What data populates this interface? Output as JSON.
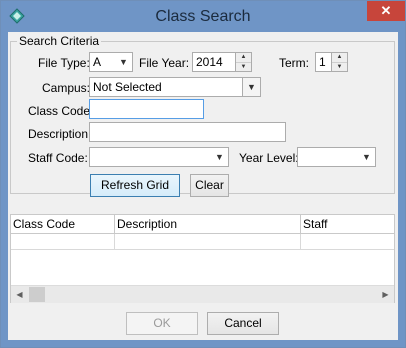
{
  "window": {
    "title": "Class Search"
  },
  "criteria": {
    "legend": "Search Criteria",
    "file_type": {
      "label": "File Type:",
      "value": "A"
    },
    "file_year": {
      "label": "File Year:",
      "value": "2014"
    },
    "term": {
      "label": "Term:",
      "value": "1"
    },
    "campus": {
      "label": "Campus:",
      "value": "Not Selected"
    },
    "class_code": {
      "label": "Class Code:",
      "value": ""
    },
    "description": {
      "label": "Description:",
      "value": ""
    },
    "staff_code": {
      "label": "Staff Code:",
      "value": ""
    },
    "year_level": {
      "label": "Year Level:",
      "value": ""
    },
    "refresh_label": "Refresh Grid",
    "clear_label": "Clear"
  },
  "grid": {
    "columns": [
      "Class Code",
      "Description",
      "Staff"
    ]
  },
  "footer": {
    "ok_label": "OK",
    "cancel_label": "Cancel"
  },
  "icons": {
    "app": "diamond-app-icon",
    "close": "close-icon",
    "dropdown": "chevron-down-icon",
    "spin_up": "spin-up-icon",
    "spin_down": "spin-down-icon"
  },
  "colors": {
    "titlebar": "#6f95c6",
    "close": "#c7453b",
    "focus_border": "#569de5"
  }
}
